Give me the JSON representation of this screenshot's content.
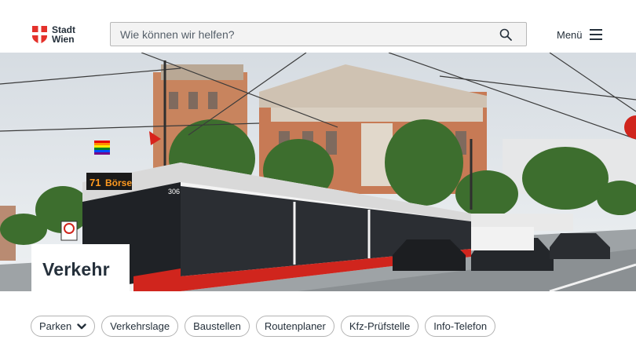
{
  "header": {
    "logo": {
      "line1": "Stadt",
      "line2": "Wien"
    },
    "search": {
      "placeholder": "Wie können wir helfen?",
      "icon": "search-icon"
    },
    "menu": {
      "label": "Menü",
      "icon": "hamburger-icon"
    }
  },
  "hero": {
    "image": "tram-street-scene",
    "tram_display": {
      "route": "71",
      "destination": "Börse",
      "fleet_number": "306"
    },
    "title": "Verkehr"
  },
  "chips": [
    {
      "label": "Parken",
      "has_dropdown": true
    },
    {
      "label": "Verkehrslage"
    },
    {
      "label": "Baustellen"
    },
    {
      "label": "Routenplaner"
    },
    {
      "label": "Kfz-Prüfstelle"
    },
    {
      "label": "Info-Telefon"
    }
  ],
  "colors": {
    "brand_red": "#e4312b",
    "text": "#25303b",
    "tram_red": "#d0251d"
  }
}
